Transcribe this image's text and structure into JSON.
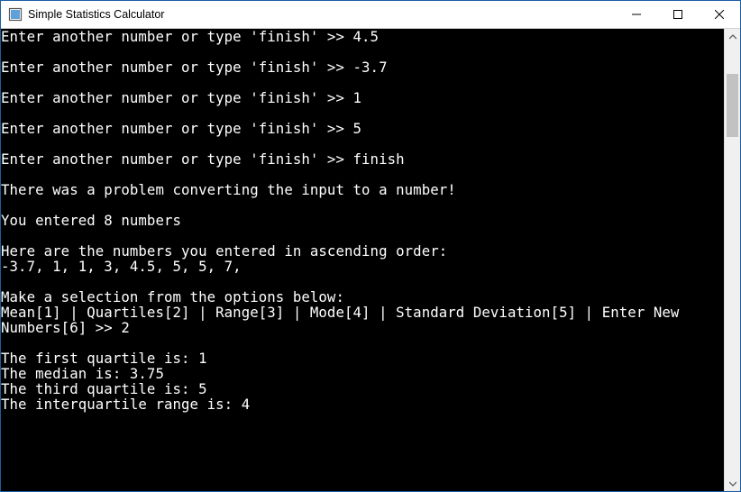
{
  "window": {
    "title": "Simple Statistics Calculator"
  },
  "console": {
    "lines": [
      "Enter another number or type 'finish' >> 4.5",
      "",
      "Enter another number or type 'finish' >> -3.7",
      "",
      "Enter another number or type 'finish' >> 1",
      "",
      "Enter another number or type 'finish' >> 5",
      "",
      "Enter another number or type 'finish' >> finish",
      "",
      "There was a problem converting the input to a number!",
      "",
      "You entered 8 numbers",
      "",
      "Here are the numbers you entered in ascending order:",
      "-3.7, 1, 1, 3, 4.5, 5, 5, 7,",
      "",
      "Make a selection from the options below:",
      "Mean[1] | Quartiles[2] | Range[3] | Mode[4] | Standard Deviation[5] | Enter New Numbers[6] >> 2",
      "",
      "The first quartile is: 1",
      "The median is: 3.75",
      "The third quartile is: 5",
      "The interquartile range is: 4"
    ]
  }
}
